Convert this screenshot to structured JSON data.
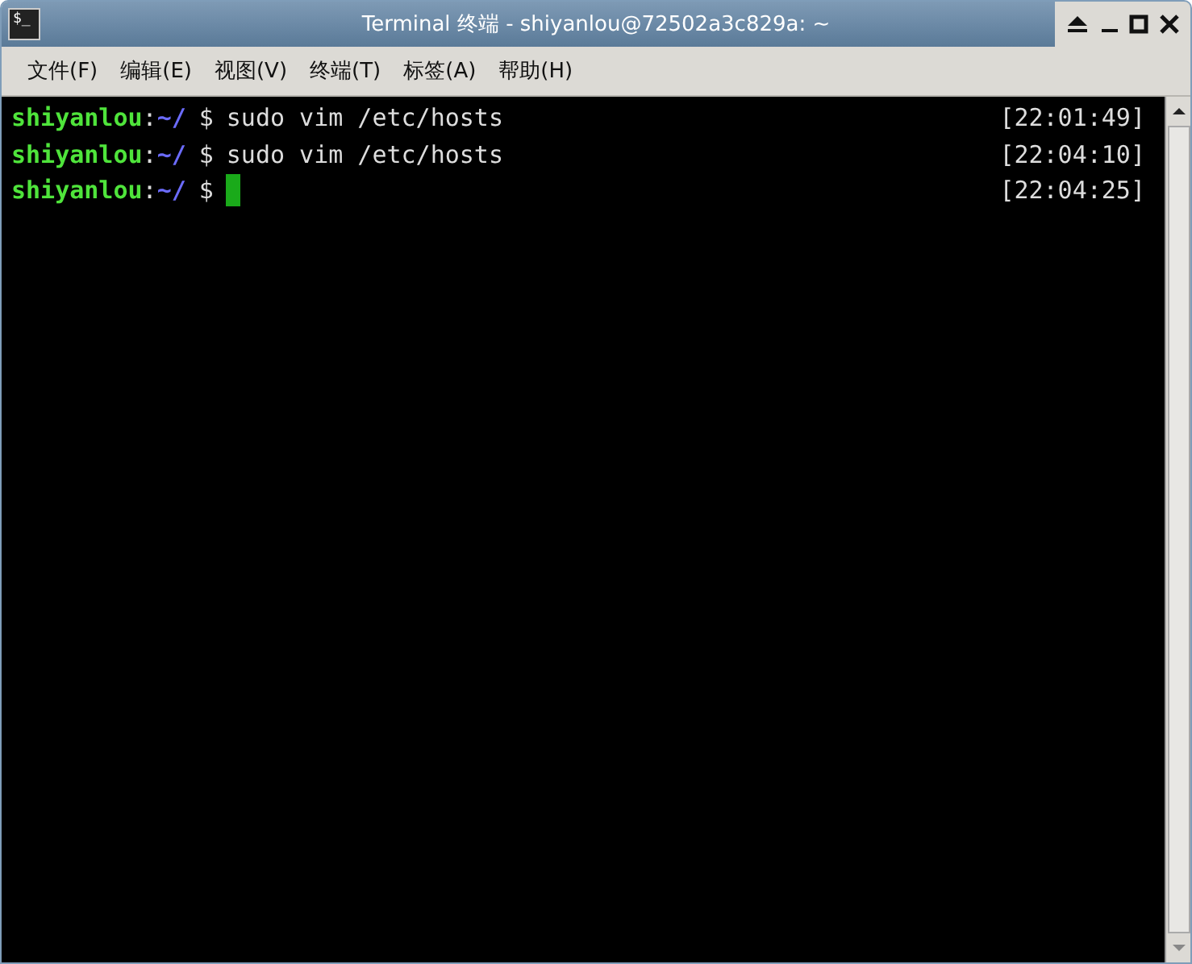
{
  "window": {
    "title": "Terminal 终端 - shiyanlou@72502a3c829a: ~",
    "icon": "$_"
  },
  "menu": [
    {
      "label": "文件(F)"
    },
    {
      "label": "编辑(E)"
    },
    {
      "label": "视图(V)"
    },
    {
      "label": "终端(T)"
    },
    {
      "label": "标签(A)"
    },
    {
      "label": "帮助(H)"
    }
  ],
  "terminal": {
    "lines": [
      {
        "user": "shiyanlou",
        "sep": ":",
        "path": "~/",
        "symbol": "$",
        "command": "sudo vim /etc/hosts",
        "time": "[22:01:49]",
        "cursor": false
      },
      {
        "user": "shiyanlou",
        "sep": ":",
        "path": "~/",
        "symbol": "$",
        "command": "sudo vim /etc/hosts",
        "time": "[22:04:10]",
        "cursor": false
      },
      {
        "user": "shiyanlou",
        "sep": ":",
        "path": "~/",
        "symbol": "$",
        "time": "[22:04:25]",
        "cursor": true
      }
    ]
  }
}
